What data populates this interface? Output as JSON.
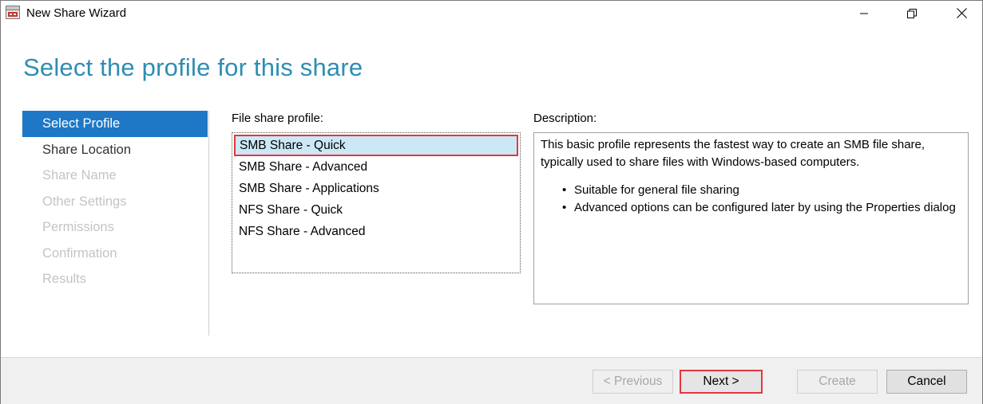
{
  "window": {
    "title": "New Share Wizard",
    "controls": {
      "minimize": "minimize",
      "maximize": "restore",
      "close": "close"
    }
  },
  "page": {
    "title": "Select the profile for this share"
  },
  "nav": {
    "items": [
      {
        "label": "Select Profile",
        "state": "active"
      },
      {
        "label": "Share Location",
        "state": "enabled"
      },
      {
        "label": "Share Name",
        "state": "disabled"
      },
      {
        "label": "Other Settings",
        "state": "disabled"
      },
      {
        "label": "Permissions",
        "state": "disabled"
      },
      {
        "label": "Confirmation",
        "state": "disabled"
      },
      {
        "label": "Results",
        "state": "disabled"
      }
    ]
  },
  "profiles": {
    "label": "File share profile:",
    "items": [
      {
        "label": "SMB Share - Quick",
        "selected": true
      },
      {
        "label": "SMB Share - Advanced",
        "selected": false
      },
      {
        "label": "SMB Share - Applications",
        "selected": false
      },
      {
        "label": "NFS Share - Quick",
        "selected": false
      },
      {
        "label": "NFS Share - Advanced",
        "selected": false
      }
    ]
  },
  "description": {
    "label": "Description:",
    "text": "This basic profile represents the fastest way to create an SMB file share, typically used to share files with Windows-based computers.",
    "bullets": [
      "Suitable for general file sharing",
      "Advanced options can be configured later by using the Properties dialog"
    ]
  },
  "buttons": {
    "previous": "< Previous",
    "next": "Next >",
    "create": "Create",
    "cancel": "Cancel"
  },
  "colors": {
    "accent_title": "#2e8db3",
    "nav_active": "#1e78c6",
    "selection_bg": "#cce8f6",
    "highlight_border": "#e0383e"
  }
}
